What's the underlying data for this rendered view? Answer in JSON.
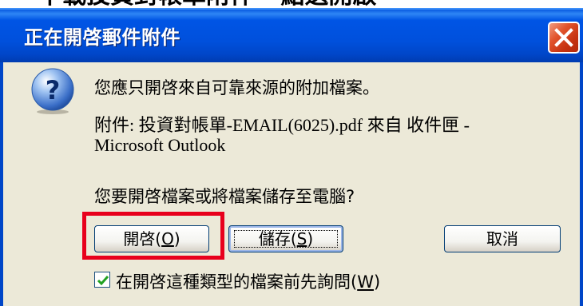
{
  "header_fragment": "下載投資對帳單附件 - 點選開啟",
  "dialog": {
    "title": "正在開啓郵件附件",
    "message_1": "您應只開啓來自可靠來源的附加檔案。",
    "attachment_line_1": "附件: 投資對帳單-EMAIL(6025).pdf 來自 收件匣 -",
    "attachment_line_2": "Microsoft Outlook",
    "question": "您要開啓檔案或將檔案儲存至電腦?",
    "buttons": {
      "open_label": "開啓(",
      "open_key": "O",
      "save_label": "儲存(",
      "save_key": "S",
      "cancel_label": "取消"
    },
    "checkbox": {
      "checked": true,
      "label_text": "在開啓這種類型的檔案前先詢問(",
      "label_key": "W"
    }
  },
  "colors": {
    "titlebar": "#0050dc",
    "client_bg": "#ece9d8",
    "highlight": "#e8001c",
    "close_button": "#c63210"
  },
  "icons": [
    "question-icon",
    "close-icon",
    "checkmark-icon"
  ]
}
